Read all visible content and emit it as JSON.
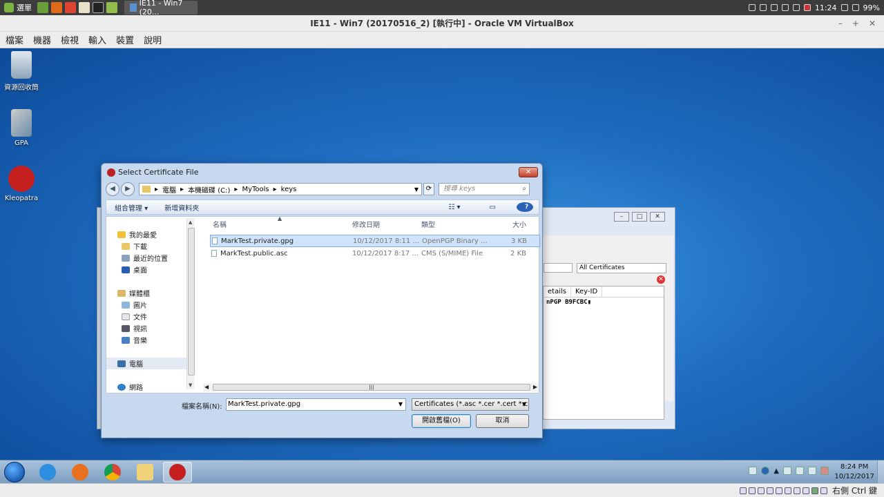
{
  "host_panel": {
    "menu_label": "選單",
    "task_label": "IE11 - Win7 (20...",
    "clock": "11:24",
    "battery": "99%"
  },
  "vbox": {
    "title": "IE11 - Win7 (20170516_2) [執行中] - Oracle VM VirtualBox",
    "menu": [
      "檔案",
      "機器",
      "檢視",
      "輸入",
      "裝置",
      "說明"
    ],
    "host_key": "右側 Ctrl 鍵"
  },
  "desktop": {
    "icons": [
      {
        "label": "資源回收筒"
      },
      {
        "label": "GPA"
      },
      {
        "label": "Kleopatra"
      }
    ]
  },
  "kleopatra": {
    "filter_combo": "All Certificates",
    "columns": [
      "etails",
      "Key-ID"
    ],
    "row": "nPGP  B9FCBC▮"
  },
  "dialog": {
    "title": "Select Certificate File",
    "breadcrumb": [
      "電腦",
      "本機磁碟 (C:)",
      "MyTools",
      "keys"
    ],
    "search_placeholder": "搜尋 keys",
    "organize": "組合管理 ▾",
    "new_folder": "新增資料夾",
    "tree": {
      "favorites": "我的最愛",
      "downloads": "下載",
      "recent": "最近的位置",
      "desktop": "桌面",
      "libraries": "媒體櫃",
      "pictures": "圖片",
      "documents": "文件",
      "videos": "視訊",
      "music": "音樂",
      "computer": "電腦",
      "network": "網路"
    },
    "columns": {
      "name": "名稱",
      "date": "修改日期",
      "type": "類型",
      "size": "大小"
    },
    "files": [
      {
        "name": "MarkTest.private.gpg",
        "date": "10/12/2017 8:11 ...",
        "type": "OpenPGP Binary ...",
        "size": "3 KB"
      },
      {
        "name": "MarkTest.public.asc",
        "date": "10/12/2017 8:17 ...",
        "type": "CMS (S/MIME) File",
        "size": "2 KB"
      }
    ],
    "filename_label": "檔案名稱(N):",
    "filename_value": "MarkTest.private.gpg",
    "filetype": "Certificates (*.asc *.cer *.cert *.crt",
    "open_button": "開啟舊檔(O)",
    "cancel_button": "取消"
  },
  "taskbar": {
    "time": "8:24 PM",
    "date": "10/12/2017"
  },
  "colors": {
    "desktop_bg": "#1f6cc0",
    "dialog_frame": "#c7d9ee",
    "selection": "#cfe3fb"
  }
}
